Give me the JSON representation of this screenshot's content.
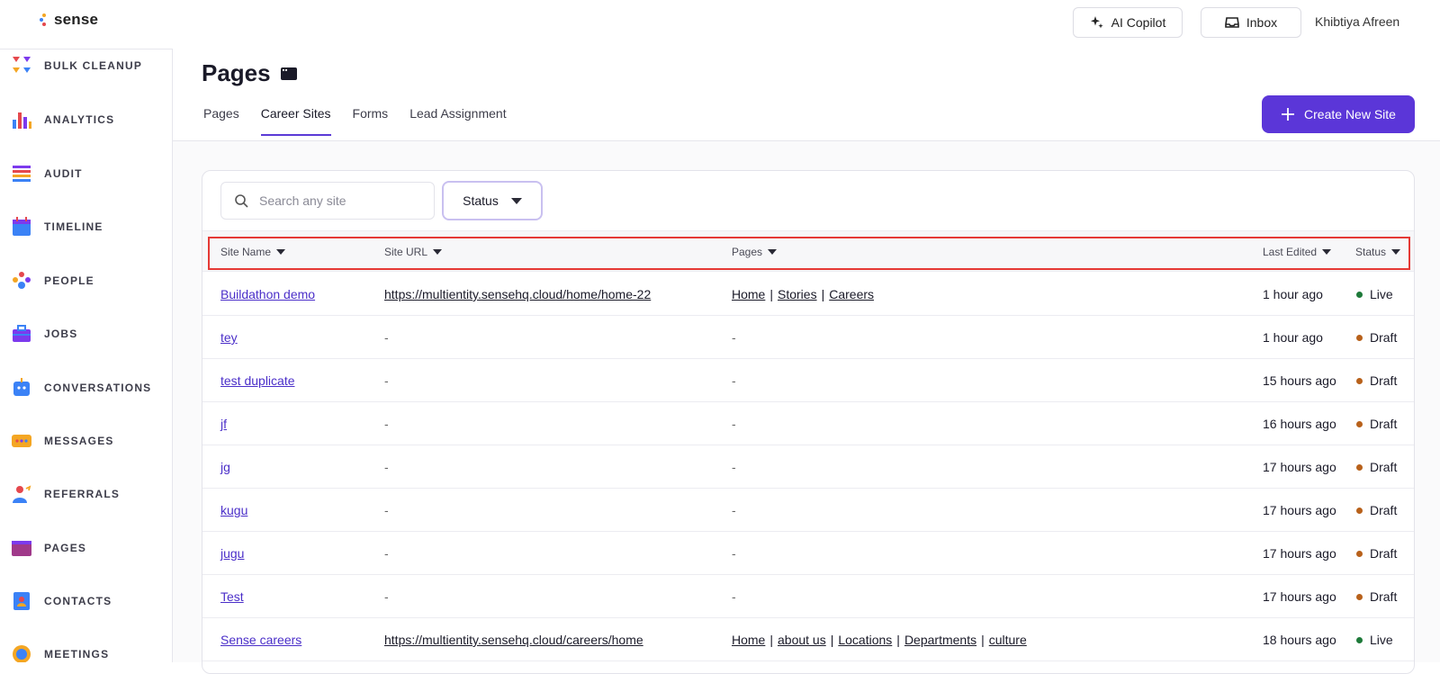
{
  "app": {
    "logo_text": "sense"
  },
  "header": {
    "copilot_label": "AI Copilot",
    "inbox_label": "Inbox",
    "user_name": "Khibtiya Afreen"
  },
  "sidebar": {
    "items": [
      {
        "label": "BULK CLEANUP",
        "icon": "bulk-cleanup-icon"
      },
      {
        "label": "ANALYTICS",
        "icon": "analytics-icon"
      },
      {
        "label": "AUDIT",
        "icon": "audit-icon"
      },
      {
        "label": "TIMELINE",
        "icon": "timeline-icon"
      },
      {
        "label": "PEOPLE",
        "icon": "people-icon"
      },
      {
        "label": "JOBS",
        "icon": "jobs-icon"
      },
      {
        "label": "CONVERSATIONS",
        "icon": "conversations-icon"
      },
      {
        "label": "MESSAGES",
        "icon": "messages-icon"
      },
      {
        "label": "REFERRALS",
        "icon": "referrals-icon"
      },
      {
        "label": "PAGES",
        "icon": "pages-icon"
      },
      {
        "label": "CONTACTS",
        "icon": "contacts-icon"
      },
      {
        "label": "MEETINGS",
        "icon": "meetings-icon"
      }
    ]
  },
  "main": {
    "title": "Pages",
    "tabs": [
      {
        "label": "Pages",
        "active": false
      },
      {
        "label": "Career Sites",
        "active": true
      },
      {
        "label": "Forms",
        "active": false
      },
      {
        "label": "Lead Assignment",
        "active": false
      }
    ],
    "create_button": "Create New Site",
    "search_placeholder": "Search any site",
    "status_filter_label": "Status"
  },
  "table": {
    "headers": {
      "site_name": "Site Name",
      "site_url": "Site URL",
      "pages": "Pages",
      "last_edited": "Last Edited",
      "status": "Status"
    },
    "rows": [
      {
        "name": "Buildathon demo",
        "url": "https://multientity.sensehq.cloud/home/home-22",
        "pages": [
          "Home",
          "Stories",
          "Careers"
        ],
        "last_edited": "1 hour ago",
        "status": "Live"
      },
      {
        "name": "tey",
        "url": "-",
        "pages": [],
        "pages_text": "-",
        "last_edited": "1 hour ago",
        "status": "Draft"
      },
      {
        "name": "test duplicate",
        "url": "-",
        "pages": [],
        "pages_text": "-",
        "last_edited": "15 hours ago",
        "status": "Draft"
      },
      {
        "name": "jf",
        "url": "-",
        "pages": [],
        "pages_text": "-",
        "last_edited": "16 hours ago",
        "status": "Draft"
      },
      {
        "name": "jg",
        "url": "-",
        "pages": [],
        "pages_text": "-",
        "last_edited": "17 hours ago",
        "status": "Draft"
      },
      {
        "name": "kugu",
        "url": "-",
        "pages": [],
        "pages_text": "-",
        "last_edited": "17 hours ago",
        "status": "Draft"
      },
      {
        "name": "jugu",
        "url": "-",
        "pages": [],
        "pages_text": "-",
        "last_edited": "17 hours ago",
        "status": "Draft"
      },
      {
        "name": "Test",
        "url": "-",
        "pages": [],
        "pages_text": "-",
        "last_edited": "17 hours ago",
        "status": "Draft"
      },
      {
        "name": "Sense careers",
        "url": "https://multientity.sensehq.cloud/careers/home",
        "pages": [
          "Home",
          "about us",
          "Locations",
          "Departments",
          "culture"
        ],
        "last_edited": "18 hours ago",
        "status": "Live"
      }
    ]
  },
  "colors": {
    "accent": "#5b36d8",
    "live": "#1e7a3a",
    "draft": "#b8611b",
    "highlight": "#e53935"
  }
}
